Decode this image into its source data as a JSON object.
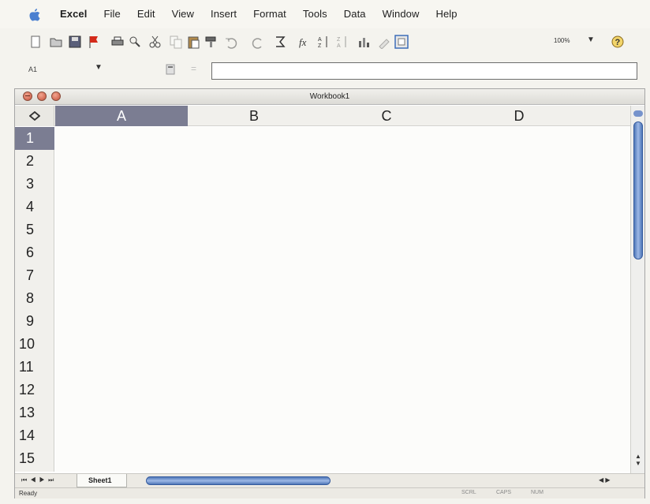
{
  "menubar": {
    "items": [
      "Excel",
      "File",
      "Edit",
      "View",
      "Insert",
      "Format",
      "Tools",
      "Data",
      "Window",
      "Help"
    ]
  },
  "toolbar": {
    "icons": [
      "new-icon",
      "open-icon",
      "save-icon",
      "flag-icon",
      "print-icon",
      "print-preview-icon",
      "cut-icon",
      "copy-icon",
      "paste-icon",
      "format-painter-icon",
      "undo-icon",
      "redo-icon",
      "autosum-icon",
      "function-icon",
      "sort-ascending-icon",
      "sort-descending-icon",
      "chart-wizard-icon",
      "drawing-icon",
      "gallery-icon",
      "help-icon"
    ],
    "zoom": "100%"
  },
  "formula_bar": {
    "name_box": "A1",
    "equals": "=",
    "value": ""
  },
  "workbook": {
    "title": "Workbook1",
    "columns": [
      "A",
      "B",
      "C",
      "D"
    ],
    "rows": [
      "1",
      "2",
      "3",
      "4",
      "5",
      "6",
      "7",
      "8",
      "9",
      "10",
      "11",
      "12",
      "13",
      "14",
      "15"
    ],
    "selected_cell": "A1"
  },
  "sheets": {
    "tabs": [
      "Sheet1"
    ]
  },
  "status": {
    "text": "Ready",
    "indicators": [
      "SCRL",
      "CAPS",
      "NUM"
    ]
  },
  "colors": {
    "selection": "#7b7d92",
    "scroll_thumb": "#6f92d0"
  }
}
